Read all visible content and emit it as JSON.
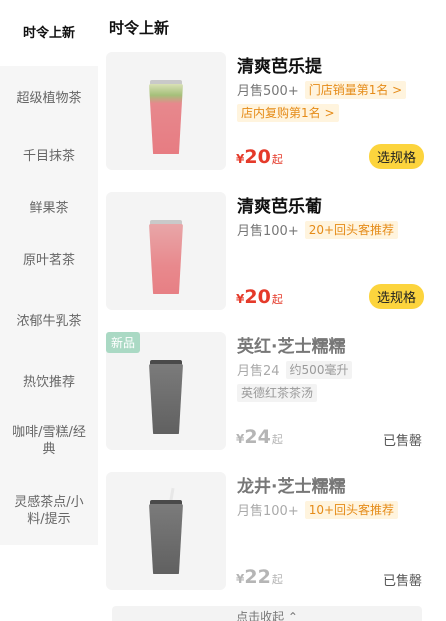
{
  "sidebar": {
    "items": [
      {
        "label": "时令上新"
      },
      {
        "label": "超级植物茶"
      },
      {
        "label": "千目抹茶"
      },
      {
        "label": "鲜果茶"
      },
      {
        "label": "原叶茗茶"
      },
      {
        "label": "浓郁牛乳茶"
      },
      {
        "label": "热饮推荐"
      },
      {
        "label": "咖啡/雪糕/经典"
      },
      {
        "label": "灵感茶点/小料/提示"
      }
    ]
  },
  "section": {
    "title": "时令上新"
  },
  "products": [
    {
      "name": "清爽芭乐提",
      "sales": "月售500+",
      "tags": [
        "门店销量第1名 >",
        "店内复购第1名 >"
      ],
      "currency": "¥",
      "price": "20",
      "unit": "起",
      "action": "选规格"
    },
    {
      "name": "清爽芭乐葡",
      "sales": "月售100+",
      "tags": [
        "20+回头客推荐"
      ],
      "currency": "¥",
      "price": "20",
      "unit": "起",
      "action": "选规格"
    },
    {
      "badge": "新品",
      "name": "英红·芝士糯糯",
      "sales": "月售24",
      "tags": [
        "约500毫升",
        "英德红茶茶汤"
      ],
      "currency": "¥",
      "price": "24",
      "unit": "起",
      "status": "已售罄"
    },
    {
      "name": "龙井·芝士糯糯",
      "sales": "月售100+",
      "tags": [
        "10+回头客推荐"
      ],
      "currency": "¥",
      "price": "22",
      "unit": "起",
      "status": "已售罄"
    }
  ],
  "collapse": {
    "label": "点击收起 ⌃"
  },
  "colors": {
    "accent_yellow": "#fcd43d",
    "price_red": "#e53a2a",
    "tag_orange": "#e58b18"
  }
}
